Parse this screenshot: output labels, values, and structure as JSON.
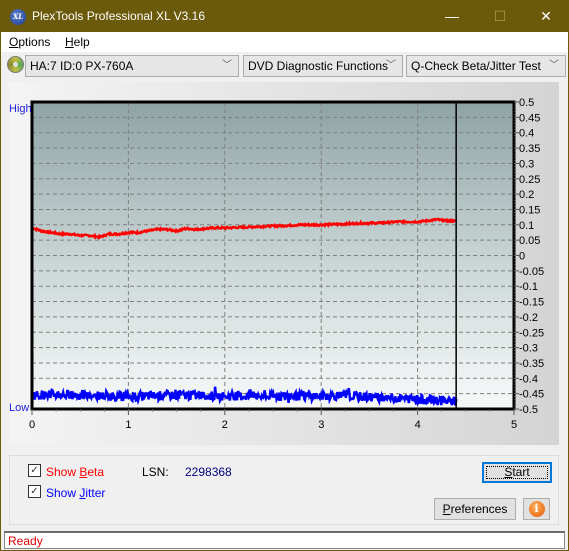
{
  "window": {
    "title": "PlexTools Professional XL V3.16",
    "app_icon_text": "XL",
    "minimize_glyph": "—",
    "maximize_glyph": "☐",
    "close_glyph": "✕"
  },
  "menu": {
    "items": [
      {
        "label": "Options",
        "accel": "O",
        "rest": "ptions"
      },
      {
        "label": "Help",
        "accel": "H",
        "rest": "elp"
      }
    ]
  },
  "toolbar": {
    "drive_combo": "HA:7 ID:0  PX-760A",
    "function_combo": "DVD Diagnostic Functions",
    "test_combo": "Q-Check Beta/Jitter Test",
    "chevron_glyph": "﹀"
  },
  "chart_data": {
    "type": "line",
    "title": "",
    "xlabel": "",
    "ylabel": "",
    "y_left_labels": {
      "top": "High",
      "bottom": "Low"
    },
    "xlim": [
      0,
      5
    ],
    "ylim": [
      -0.5,
      0.5
    ],
    "x_ticks": [
      "0",
      "1",
      "2",
      "3",
      "4",
      "5"
    ],
    "y_ticks": [
      "0.5",
      "0.45",
      "0.4",
      "0.35",
      "0.3",
      "0.25",
      "0.2",
      "0.15",
      "0.1",
      "0.05",
      "0",
      "-0.05",
      "-0.1",
      "-0.15",
      "-0.2",
      "-0.25",
      "-0.3",
      "-0.35",
      "-0.4",
      "-0.45",
      "-0.5"
    ],
    "grid": true,
    "end_marker_x": 4.4,
    "series": [
      {
        "name": "Beta",
        "color": "#ff0000",
        "x": [
          0,
          0.1,
          0.2,
          0.3,
          0.4,
          0.5,
          0.6,
          0.7,
          0.8,
          0.9,
          1.0,
          1.1,
          1.2,
          1.3,
          1.4,
          1.5,
          1.6,
          1.7,
          1.8,
          1.9,
          2.0,
          2.2,
          2.4,
          2.6,
          2.8,
          3.0,
          3.2,
          3.4,
          3.6,
          3.8,
          4.0,
          4.1,
          4.2,
          4.3,
          4.4
        ],
        "values": [
          0.09,
          0.08,
          0.075,
          0.07,
          0.07,
          0.065,
          0.065,
          0.06,
          0.07,
          0.07,
          0.075,
          0.075,
          0.08,
          0.085,
          0.085,
          0.08,
          0.088,
          0.085,
          0.088,
          0.09,
          0.09,
          0.092,
          0.095,
          0.097,
          0.1,
          0.1,
          0.102,
          0.105,
          0.106,
          0.11,
          0.11,
          0.113,
          0.117,
          0.113,
          0.112
        ]
      },
      {
        "name": "Jitter",
        "color": "#0000ff",
        "x": [
          0,
          0.2,
          0.4,
          0.6,
          0.8,
          1.0,
          1.2,
          1.4,
          1.6,
          1.8,
          2.0,
          2.2,
          2.4,
          2.6,
          2.8,
          3.0,
          3.2,
          3.4,
          3.6,
          3.8,
          4.0,
          4.2,
          4.4
        ],
        "values": [
          -0.455,
          -0.452,
          -0.455,
          -0.457,
          -0.458,
          -0.459,
          -0.458,
          -0.455,
          -0.455,
          -0.457,
          -0.458,
          -0.458,
          -0.459,
          -0.459,
          -0.458,
          -0.457,
          -0.456,
          -0.46,
          -0.462,
          -0.465,
          -0.468,
          -0.472,
          -0.475
        ]
      }
    ]
  },
  "controls": {
    "show_beta": {
      "label_pre": "Show ",
      "accel": "B",
      "label_post": "eta",
      "checked": true,
      "color": "#ff0000"
    },
    "show_jitter": {
      "label_pre": "Show ",
      "accel": "J",
      "label_post": "itter",
      "checked": true,
      "color": "#0000ff"
    },
    "lsn_label": "LSN:",
    "lsn_value": "2298368",
    "start_accel": "S",
    "start_rest": "tart",
    "preferences_accel": "P",
    "preferences_rest": "references",
    "info_glyph": "i",
    "check_glyph": "✓"
  },
  "status": {
    "text": "Ready"
  }
}
